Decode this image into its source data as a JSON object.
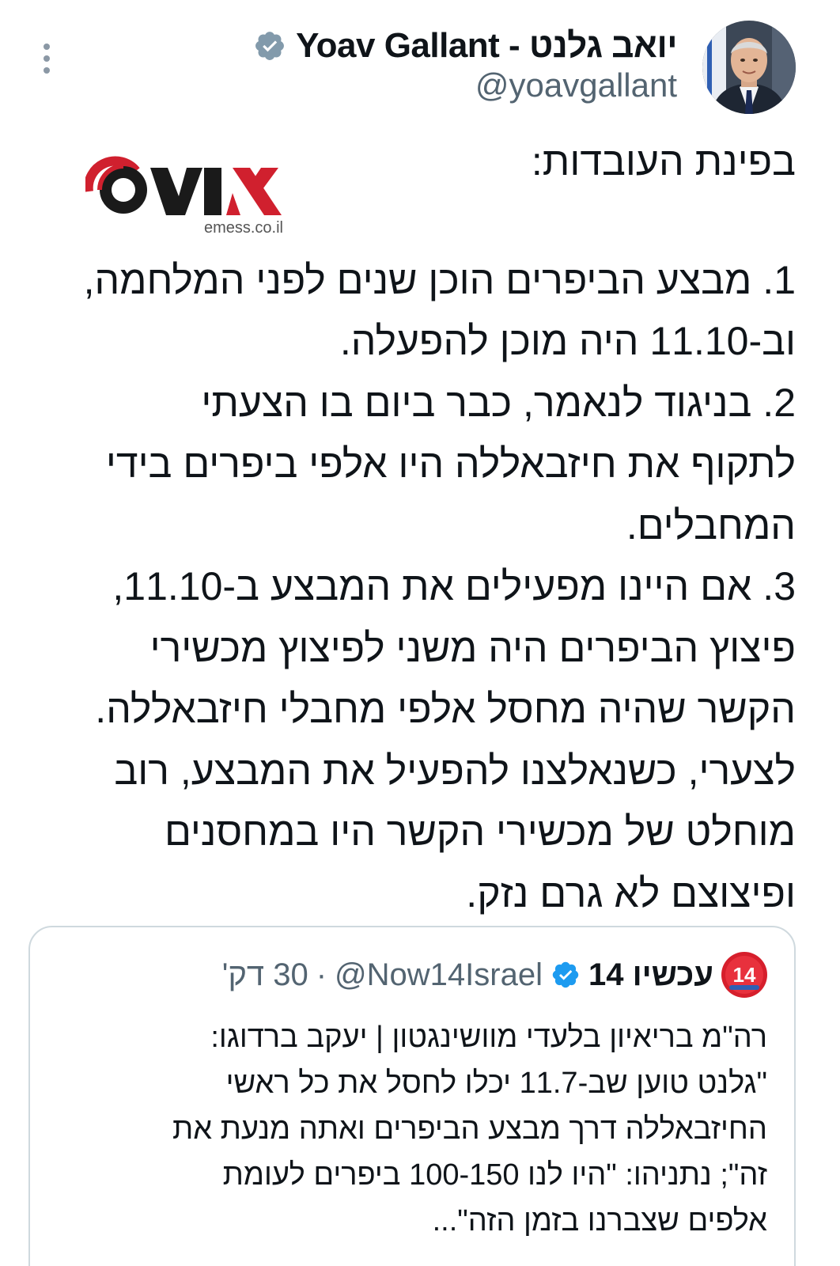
{
  "author": {
    "display_name": "Yoav Gallant - יואב גלנט",
    "handle": "@yoavgallant",
    "avatar_icon": "profile-photo",
    "verified_icon": "verified-badge-icon",
    "verified_color": "#829aab"
  },
  "watermark": {
    "logo_text": "אמס",
    "site": "emess.co.il",
    "accent": "#d0202e"
  },
  "tweet": {
    "lines": [
      "בפינת העובדות:",
      "1. מבצע הביפרים הוכן שנים לפני המלחמה,",
      "וב-11.10 היה מוכן להפעלה.",
      "2. בניגוד לנאמר, כבר ביום בו הצעתי",
      "לתקוף את חיזבאללה היו אלפי ביפרים בידי",
      "המחבלים.",
      "3. אם היינו מפעילים את המבצע ב-11.10,",
      "פיצוץ הביפרים היה משני לפיצוץ מכשירי",
      "הקשר שהיה מחסל אלפי מחבלי חיזבאללה.",
      "לצערי, כשנאלצנו להפעיל את המבצע, רוב",
      "מוחלט של מכשירי הקשר היו במחסנים",
      "ופיצוצם לא גרם נזק."
    ]
  },
  "quoted_tweet": {
    "avatar_text": "14",
    "name": "עכשיו 14",
    "verified_color": "#1d9bf0",
    "handle": "@Now14Israel",
    "separator": "·",
    "time": "30 דק'",
    "lines": [
      "רה\"מ בריאיון בלעדי מוושינגטון | יעקב ברדוגו:",
      "\"גלנט טוען שב-11.7 יכלו לחסל את כל ראשי",
      "החיזבאללה דרך מבצע הביפרים ואתה מנעת את",
      "זה\"; נתניהו: \"היו לנו 100-150 ביפרים לעומת",
      "אלפים שצברנו בזמן הזה\"..."
    ]
  }
}
